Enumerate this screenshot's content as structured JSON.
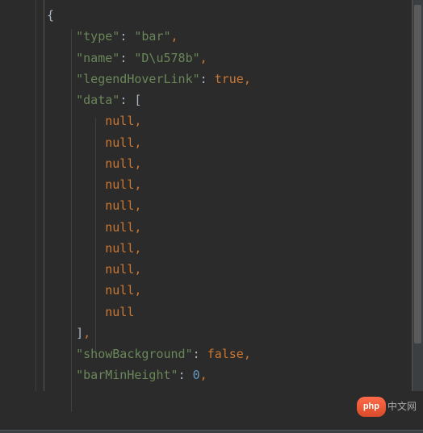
{
  "code": {
    "open_brace": "{",
    "kv_type": {
      "key": "\"type\"",
      "colon": ": ",
      "value": "\"bar\"",
      "comma": ","
    },
    "kv_name": {
      "key": "\"name\"",
      "colon": ": ",
      "value": "\"D\\u578b\"",
      "comma": ","
    },
    "kv_legendHoverLink": {
      "key": "\"legendHoverLink\"",
      "colon": ": ",
      "value": "true",
      "comma": ","
    },
    "kv_data": {
      "key": "\"data\"",
      "colon": ": ",
      "open": "["
    },
    "nulls": [
      "null,",
      "null,",
      "null,",
      "null,",
      "null,",
      "null,",
      "null,",
      "null,",
      "null,",
      "null"
    ],
    "data_close": {
      "close": "]",
      "comma": ","
    },
    "kv_showBackground": {
      "key": "\"showBackground\"",
      "colon": ": ",
      "value": "false",
      "comma": ","
    },
    "kv_barMinHeight": {
      "key": "\"barMinHeight\"",
      "colon": ": ",
      "value": "0",
      "comma": ","
    }
  },
  "watermark": {
    "pill": "php",
    "text": "中文网"
  }
}
